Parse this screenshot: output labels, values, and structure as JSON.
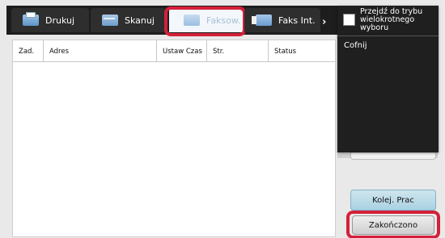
{
  "tabs": [
    {
      "label": "Drukuj",
      "icon": "printer-icon"
    },
    {
      "label": "Skanuj",
      "icon": "scanner-icon"
    },
    {
      "label": "Faksow.",
      "icon": "fax-icon",
      "active": true
    },
    {
      "label": "Faks Int.",
      "icon": "internet-fax-icon"
    }
  ],
  "table": {
    "columns": [
      "Zad.",
      "Adres",
      "Ustaw Czas",
      "Str.",
      "Status"
    ]
  },
  "dropdown": {
    "multi_select_label": "Przejdź do trybu wielokrotnego wyboru",
    "back_label": "Cofnij"
  },
  "buttons": {
    "job_queue": "Kolej. Prac",
    "completed": "Zakończono"
  },
  "colors": {
    "highlight": "#d4203a",
    "tab_bar": "#1d1d1d",
    "queue_button": "#a9d2e2"
  }
}
